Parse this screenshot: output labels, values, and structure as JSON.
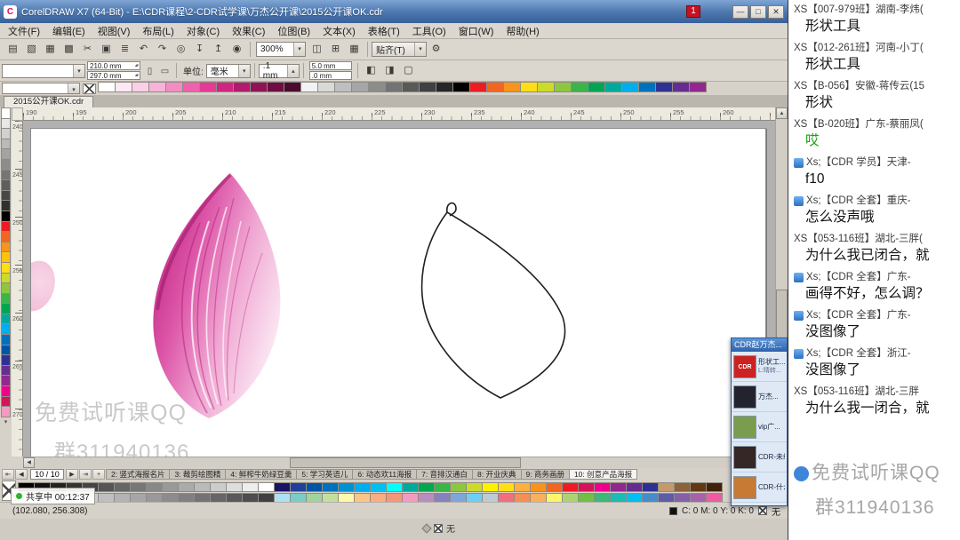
{
  "titlebar": {
    "title": "CorelDRAW X7 (64-Bit) - E:\\CDR课程\\2-CDR试学课\\万杰公开课\\2015公开课OK.cdr",
    "badge": "1",
    "minimize": "—",
    "maximize": "□",
    "close": "✕"
  },
  "menubar": [
    "文件(F)",
    "编辑(E)",
    "视图(V)",
    "布局(L)",
    "对象(C)",
    "效果(C)",
    "位图(B)",
    "文本(X)",
    "表格(T)",
    "工具(O)",
    "窗口(W)",
    "帮助(H)"
  ],
  "standard_bar": {
    "icons": [
      {
        "name": "new-document-icon",
        "glyph": "▤"
      },
      {
        "name": "open-icon",
        "glyph": "▧"
      },
      {
        "name": "save-icon",
        "glyph": "▦"
      },
      {
        "name": "print-icon",
        "glyph": "▩"
      },
      {
        "name": "cut-icon",
        "glyph": "✂"
      },
      {
        "name": "copy-icon",
        "glyph": "▣"
      },
      {
        "name": "paste-icon",
        "glyph": "≣"
      },
      {
        "name": "undo-icon",
        "glyph": "↶"
      },
      {
        "name": "redo-icon",
        "glyph": "↷"
      },
      {
        "name": "search-content-icon",
        "glyph": "◎"
      },
      {
        "name": "import-icon",
        "glyph": "↧"
      },
      {
        "name": "export-icon",
        "glyph": "↥"
      },
      {
        "name": "app-launcher-icon",
        "glyph": "◉"
      }
    ],
    "zoom_value": "300%",
    "view_icons": [
      {
        "name": "fullscreen-preview-icon",
        "glyph": "◫"
      },
      {
        "name": "show-rulers-icon",
        "glyph": "⊞"
      },
      {
        "name": "show-grid-icon",
        "glyph": "▦"
      }
    ],
    "snap_label": "贴齐(T)",
    "options_glyph": "⚙"
  },
  "property_bar": {
    "preset_value": "",
    "width_value": "210.0 mm",
    "height_value": "297.0 mm",
    "portrait_glyph": "▯",
    "landscape_glyph": "▭",
    "units_label": "单位:",
    "units_value": "毫米",
    "nudge_value": ".1 mm",
    "dup_x_value": "5.0 mm",
    "dup_y_value": ".0 mm",
    "extra_icons": [
      {
        "name": "treat-as-filled-icon",
        "glyph": "◧"
      },
      {
        "name": "show-bleed-icon",
        "glyph": "◨"
      },
      {
        "name": "page-border-icon",
        "glyph": "▢"
      }
    ]
  },
  "document": {
    "tab_label": "2015公开课OK.cdr"
  },
  "rulers": {
    "horizontal": [
      "190",
      "195",
      "200",
      "205",
      "210",
      "215",
      "220",
      "225",
      "230",
      "235",
      "240",
      "245",
      "250",
      "255",
      "260"
    ],
    "vertical": [
      "240",
      "245",
      "250",
      "255",
      "260",
      "265",
      "270"
    ]
  },
  "palettes": {
    "document": [
      "#ffffff",
      "#fde8f3",
      "#fbd0e7",
      "#f8b3d8",
      "#f48cc4",
      "#ee62ad",
      "#e53a96",
      "#cf2583",
      "#b01c6d",
      "#8f1457",
      "#6e0e42",
      "#4c0a2e",
      "#f2f2f2",
      "#d9d9d9",
      "#bfbfbf",
      "#a6a6a6",
      "#8c8c8c",
      "#737373",
      "#595959",
      "#404040",
      "#262626",
      "#000000",
      "#ed1c24",
      "#f26522",
      "#f7941d",
      "#ffde17",
      "#cbdb2a",
      "#8dc63f",
      "#39b54a",
      "#00a651",
      "#00a99d",
      "#00aeef",
      "#0072bc",
      "#2e3192",
      "#662d91",
      "#92278f"
    ],
    "left": [
      "#ffffff",
      "#e8e8e8",
      "#d1d1d1",
      "#bababa",
      "#a3a3a3",
      "#8c8c8c",
      "#757575",
      "#5e5e5e",
      "#474747",
      "#303030",
      "#000000",
      "#ed1c24",
      "#f26522",
      "#f7941d",
      "#ffc20e",
      "#ffde17",
      "#cbdb2a",
      "#8dc63f",
      "#39b54a",
      "#00a651",
      "#00a99d",
      "#00aeef",
      "#0072bc",
      "#0054a6",
      "#2e3192",
      "#662d91",
      "#92278f",
      "#ec008c",
      "#d4145a",
      "#f49ac1"
    ],
    "bottom_row1": [
      "#000000",
      "#111111",
      "#222222",
      "#333333",
      "#444444",
      "#555555",
      "#666666",
      "#777777",
      "#888888",
      "#999999",
      "#aaaaaa",
      "#bbbbbb",
      "#cccccc",
      "#dddddd",
      "#eeeeee",
      "#ffffff",
      "#1b1464",
      "#21409a",
      "#0054a6",
      "#0072bc",
      "#0091d0",
      "#00aeef",
      "#00c0f3",
      "#00ffff",
      "#00a99d",
      "#00a651",
      "#39b54a",
      "#8dc63f",
      "#cbdb2a",
      "#fff200",
      "#ffde17",
      "#fbb040",
      "#f7941d",
      "#f26522",
      "#ed1c24",
      "#d4145a",
      "#ec008c",
      "#92278f",
      "#662d91",
      "#2e3192",
      "#c49a6c",
      "#8c6239",
      "#603913",
      "#42210b"
    ],
    "bottom_row2": [
      "#ffffff",
      "#f2f2f2",
      "#e6e6e6",
      "#d9d9d9",
      "#cccccc",
      "#bfbfbf",
      "#b3b3b3",
      "#a6a6a6",
      "#999999",
      "#8c8c8c",
      "#808080",
      "#737373",
      "#666666",
      "#595959",
      "#4d4d4d",
      "#404040",
      "#aee1f4",
      "#7accc8",
      "#a3d39c",
      "#c4df9b",
      "#fff9ae",
      "#fdc689",
      "#f9ad81",
      "#f69679",
      "#f49ac1",
      "#bd8cbf",
      "#8781bd",
      "#7da7d8",
      "#6dcff6",
      "#bdccd4",
      "#f26d7d",
      "#f68e55",
      "#fbaf5c",
      "#fff568",
      "#acd372",
      "#72bf44",
      "#3cb878",
      "#1cbbb4",
      "#00bff3",
      "#448ccb",
      "#5e5ca7",
      "#855fa8",
      "#a763a8",
      "#ef5ba1"
    ]
  },
  "page_nav": {
    "position": "10 / 10",
    "tabs": [
      "2: 竖式海报名片",
      "3: 裁剪绘图精",
      "4: 鲜榨牛奶绿豆羹",
      "5: 学习英语儿",
      "6: 动态欢11海报",
      "7: 音排汉通白",
      "8: 开业庆典",
      "9: 商务画册",
      "10: 创意产品海报"
    ]
  },
  "status_bar": {
    "share_label": "共享中 00:12:37",
    "coords": "(102.080, 256.308)",
    "cmyk": "C: 0 M: 0 Y: 0 K: 0",
    "fill_label": "无",
    "outline_label": "无"
  },
  "canvas": {
    "watermark_line1": "免费试听课QQ",
    "watermark_line2": "群311940136"
  },
  "float_panel": {
    "title": "CDR赵万杰...",
    "items": [
      {
        "label": "形状工...",
        "sub": "L:晴转...",
        "thumb": "#cc2222",
        "thumb_text": "CDR"
      },
      {
        "label": "万杰...",
        "sub": "",
        "thumb": "#23232e",
        "thumb_text": ""
      },
      {
        "label": "vip广...",
        "sub": "",
        "thumb": "#7a9c4e",
        "thumb_text": ""
      },
      {
        "label": "CDR-未续...",
        "sub": "",
        "thumb": "#352726",
        "thumb_text": ""
      },
      {
        "label": "CDR-什么...",
        "sub": "",
        "thumb": "#c77a33",
        "thumb_text": ""
      }
    ]
  },
  "chat": {
    "messages": [
      {
        "sender": "XS【007-979班】湖南-李炜(",
        "text": "形状工具",
        "badge": false,
        "color": ""
      },
      {
        "sender": "XS【012-261班】河南-小丁(",
        "text": "形状工具",
        "badge": false,
        "color": ""
      },
      {
        "sender": "XS【B-056】安徽-蒋传云(15",
        "text": "形状",
        "badge": false,
        "color": ""
      },
      {
        "sender": "XS【B-020班】广东-蔡丽凤(",
        "text": "哎",
        "badge": false,
        "color": "#17a317"
      },
      {
        "sender": "Xs;【CDR 学员】天津-",
        "text": "f10",
        "badge": true,
        "color": ""
      },
      {
        "sender": "Xs;【CDR 全套】重庆-",
        "text": "怎么没声哦",
        "badge": true,
        "color": ""
      },
      {
        "sender": "XS【053-116班】湖北-三胖(",
        "text": "为什么我已闭合，就",
        "badge": false,
        "color": ""
      },
      {
        "sender": "Xs;【CDR 全套】广东-",
        "text": "画得不好，怎么调？",
        "badge": true,
        "color": ""
      },
      {
        "sender": "Xs;【CDR 全套】广东-",
        "text": "没图像了",
        "badge": true,
        "color": ""
      },
      {
        "sender": "Xs;【CDR 全套】浙江-",
        "text": "没图像了",
        "badge": true,
        "color": ""
      },
      {
        "sender": "XS【053-116班】湖北-三胖",
        "text": "为什么我一闭合，就",
        "badge": false,
        "color": ""
      }
    ],
    "watermark_line1": "免费试听课QQ",
    "watermark_line2": "群311940136"
  }
}
